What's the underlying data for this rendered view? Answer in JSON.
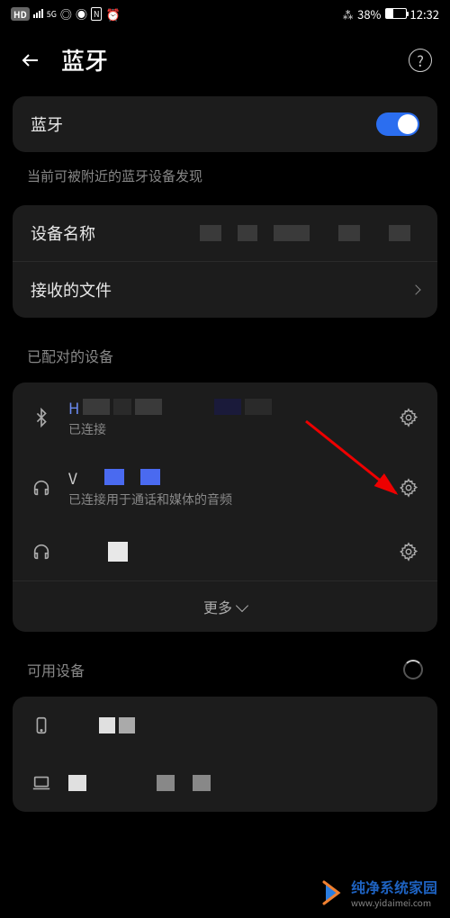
{
  "status_bar": {
    "hd_label": "HD",
    "network_label": "5G",
    "bt_percent": "38%",
    "time": "12:32",
    "bt_symbol": "✱⎋"
  },
  "header": {
    "title": "蓝牙"
  },
  "main_toggle": {
    "label": "蓝牙",
    "hint": "当前可被附近的蓝牙设备发现"
  },
  "device_info": {
    "name_label": "设备名称",
    "received_label": "接收的文件"
  },
  "paired": {
    "section_title": "已配对的设备",
    "items": [
      {
        "name_prefix": "H",
        "status": "已连接"
      },
      {
        "name_prefix": "V",
        "status": "已连接用于通话和媒体的音频"
      },
      {
        "name_prefix": "",
        "status": ""
      }
    ],
    "more_label": "更多"
  },
  "available": {
    "section_title": "可用设备"
  },
  "watermark": {
    "brand": "纯净系统家园",
    "url": "www.yidaimei.com"
  }
}
